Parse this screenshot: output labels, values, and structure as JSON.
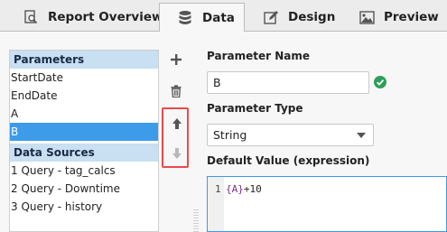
{
  "tabs": [
    {
      "label": "Report Overview",
      "icon": "report-search-icon"
    },
    {
      "label": "Data",
      "icon": "database-icon",
      "active": true
    },
    {
      "label": "Design",
      "icon": "pencil-edit-icon"
    },
    {
      "label": "Preview",
      "icon": "image-icon"
    }
  ],
  "left_panel": {
    "parameters_header": "Parameters",
    "parameters": [
      "StartDate",
      "EndDate",
      "A",
      "B"
    ],
    "selected_parameter": "B",
    "data_sources_header": "Data Sources",
    "data_sources": [
      "1 Query - tag_calcs",
      "2 Query - Downtime",
      "3 Query - history"
    ]
  },
  "toolbar": {
    "add_icon": "plus-icon",
    "delete_icon": "trash-icon",
    "move_up_icon": "arrow-up-icon",
    "move_down_icon": "arrow-down-icon"
  },
  "form": {
    "param_name_label": "Parameter Name",
    "param_name_value": "B",
    "param_type_label": "Parameter Type",
    "param_type_value": "String",
    "default_value_label": "Default Value (expression)",
    "code_line_number": "1",
    "code_ref": "{A}",
    "code_rest": "+10"
  },
  "colors": {
    "selection": "#3d9be9",
    "section_header": "#c9dff2",
    "highlight_border": "#e84b4b",
    "valid_check": "#2e9e5b",
    "code_reference": "#7a2e8e"
  }
}
